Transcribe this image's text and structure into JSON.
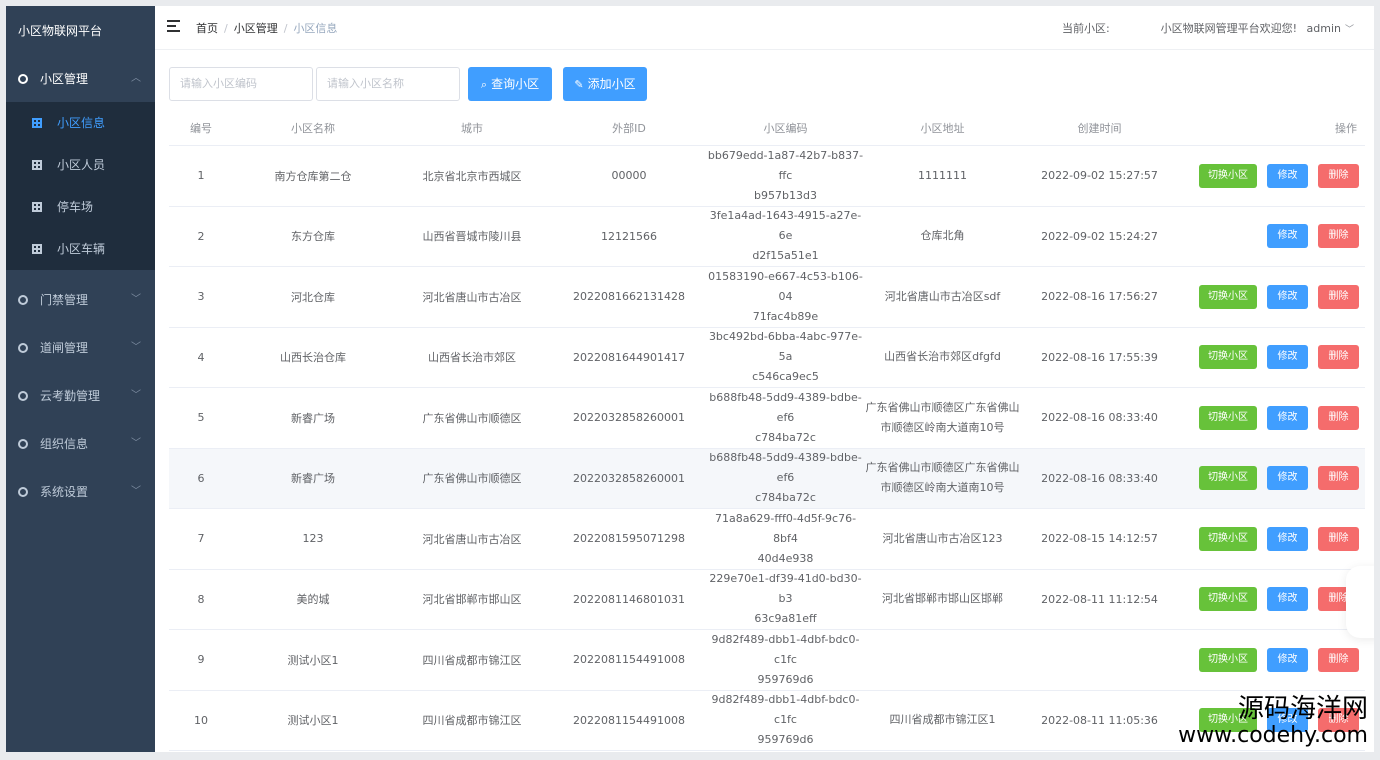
{
  "sidebar": {
    "title": "小区物联网平台",
    "menus": [
      {
        "label": "小区管理",
        "open": true,
        "arrow": "︿"
      },
      {
        "label": "门禁管理",
        "arrow": "﹀"
      },
      {
        "label": "道闸管理",
        "arrow": "﹀"
      },
      {
        "label": "云考勤管理",
        "arrow": "﹀"
      },
      {
        "label": "组织信息",
        "arrow": "﹀"
      },
      {
        "label": "系统设置",
        "arrow": "﹀"
      }
    ],
    "submenu": [
      {
        "label": "小区信息",
        "active": true
      },
      {
        "label": "小区人员"
      },
      {
        "label": "停车场"
      },
      {
        "label": "小区车辆"
      }
    ]
  },
  "navbar": {
    "breadcrumb": [
      "首页",
      "小区管理",
      "小区信息"
    ],
    "current_label": "当前小区:",
    "welcome": "小区物联网管理平台欢迎您!",
    "user": "admin"
  },
  "toolbar": {
    "code_placeholder": "请输入小区编码",
    "name_placeholder": "请输入小区名称",
    "query_label": "查询小区",
    "add_label": "添加小区"
  },
  "table": {
    "headers": [
      "编号",
      "小区名称",
      "城市",
      "外部ID",
      "小区编码",
      "小区地址",
      "创建时间",
      "操作"
    ],
    "rows": [
      {
        "no": "1",
        "name": "南方仓库第二仓",
        "city": "北京省北京市西城区",
        "ext_id": "00000",
        "code1": "bb679edd-1a87-42b7-b837-ffc",
        "code2": "b957b13d3",
        "addr1": "1111111",
        "addr2": "",
        "time": "2022-09-02 15:27:57",
        "switch": true
      },
      {
        "no": "2",
        "name": "东方仓库",
        "city": "山西省晋城市陵川县",
        "ext_id": "12121566",
        "code1": "3fe1a4ad-1643-4915-a27e-6e",
        "code2": "d2f15a51e1",
        "addr1": "仓库北角",
        "addr2": "",
        "time": "2022-09-02 15:24:27",
        "switch": false
      },
      {
        "no": "3",
        "name": "河北仓库",
        "city": "河北省唐山市古冶区",
        "ext_id": "2022081662131428",
        "code1": "01583190-e667-4c53-b106-04",
        "code2": "71fac4b89e",
        "addr1": "河北省唐山市古冶区sdf",
        "addr2": "",
        "time": "2022-08-16 17:56:27",
        "switch": true
      },
      {
        "no": "4",
        "name": "山西长治仓库",
        "city": "山西省长治市郊区",
        "ext_id": "2022081644901417",
        "code1": "3bc492bd-6bba-4abc-977e-5a",
        "code2": "c546ca9ec5",
        "addr1": "山西省长治市郊区dfgfd",
        "addr2": "",
        "time": "2022-08-16 17:55:39",
        "switch": true
      },
      {
        "no": "5",
        "name": "新睿广场",
        "city": "广东省佛山市顺德区",
        "ext_id": "2022032858260001",
        "code1": "b688fb48-5dd9-4389-bdbe-ef6",
        "code2": "c784ba72c",
        "addr1": "广东省佛山市顺德区广东省佛山",
        "addr2": "市顺德区岭南大道南10号",
        "time": "2022-08-16 08:33:40",
        "switch": true
      },
      {
        "no": "6",
        "name": "新睿广场",
        "city": "广东省佛山市顺德区",
        "ext_id": "2022032858260001",
        "code1": "b688fb48-5dd9-4389-bdbe-ef6",
        "code2": "c784ba72c",
        "addr1": "广东省佛山市顺德区广东省佛山",
        "addr2": "市顺德区岭南大道南10号",
        "time": "2022-08-16 08:33:40",
        "switch": true
      },
      {
        "no": "7",
        "name": "123",
        "city": "河北省唐山市古冶区",
        "ext_id": "2022081595071298",
        "code1": "71a8a629-fff0-4d5f-9c76-8bf4",
        "code2": "40d4e938",
        "addr1": "河北省唐山市古冶区123",
        "addr2": "",
        "time": "2022-08-15 14:12:57",
        "switch": true
      },
      {
        "no": "8",
        "name": "美的城",
        "city": "河北省邯郸市邯山区",
        "ext_id": "2022081146801031",
        "code1": "229e70e1-df39-41d0-bd30-b3",
        "code2": "63c9a81eff",
        "addr1": "河北省邯郸市邯山区邯郸",
        "addr2": "",
        "time": "2022-08-11 11:12:54",
        "switch": true
      },
      {
        "no": "9",
        "name": "测试小区1",
        "city": "四川省成都市锦江区",
        "ext_id": "2022081154491008",
        "code1": "9d82f489-dbb1-4dbf-bdc0-c1fc",
        "code2": "959769d6",
        "addr1": "",
        "addr2": "",
        "time": "",
        "switch": true
      },
      {
        "no": "10",
        "name": "测试小区1",
        "city": "四川省成都市锦江区",
        "ext_id": "2022081154491008",
        "code1": "9d82f489-dbb1-4dbf-bdc0-c1fc",
        "code2": "959769d6",
        "addr1": "四川省成都市锦江区1",
        "addr2": "",
        "time": "2022-08-11 11:05:36",
        "switch": true
      }
    ],
    "actions": {
      "switch": "切换小区",
      "edit": "修改",
      "del": "删除"
    }
  },
  "watermark": {
    "line1": "源码海洋网",
    "line2": "www.codehy.com"
  },
  "colors": {
    "sidebar": "#304156",
    "submenu": "#1f2d3d",
    "primary": "#409eff",
    "success": "#67c23a",
    "danger": "#f56c6c"
  }
}
